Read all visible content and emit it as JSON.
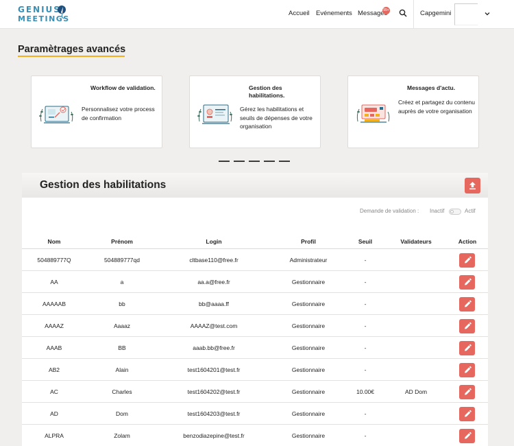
{
  "header": {
    "logo_line1": "GENIUS",
    "logo_line2": "MEETINGS",
    "nav": [
      "Accueil",
      "Evénements",
      "Messages"
    ],
    "messages_badge": "99+",
    "company": "Capgemini"
  },
  "page": {
    "title": "Paramètrages avancés"
  },
  "cards": [
    {
      "title": "Workflow de validation.",
      "description": "Personnalisez votre process de confirmation"
    },
    {
      "title": "Gestion des habilitations.",
      "description": "Gérez les habilitations et seuils de dépenses de votre organisation"
    },
    {
      "title": "Messages d'actu.",
      "description": "Créez et partagez du contenu auprès de votre organisation"
    }
  ],
  "panel": {
    "title": "Gestion des habilitations",
    "validation_label": "Demande de validation :",
    "inactive_label": "Inactif",
    "active_label": "Actif"
  },
  "table": {
    "columns": [
      "Nom",
      "Prénom",
      "Login",
      "Profil",
      "Seuil",
      "Validateurs",
      "Action"
    ],
    "rows": [
      {
        "nom": "504889777Q",
        "prenom": "504889777qd",
        "login": "cltbase110@free.fr",
        "profil": "Administrateur",
        "seuil": "-",
        "validateurs": ""
      },
      {
        "nom": "AA",
        "prenom": "a",
        "login": "aa.a@free.fr",
        "profil": "Gestionnaire",
        "seuil": "-",
        "validateurs": ""
      },
      {
        "nom": "AAAAAB",
        "prenom": "bb",
        "login": "bb@aaaa.ff",
        "profil": "Gestionnaire",
        "seuil": "-",
        "validateurs": ""
      },
      {
        "nom": "AAAAZ",
        "prenom": "Aaaaz",
        "login": "AAAAZ@test.com",
        "profil": "Gestionnaire",
        "seuil": "-",
        "validateurs": ""
      },
      {
        "nom": "AAAB",
        "prenom": "BB",
        "login": "aaab.bb@free.fr",
        "profil": "Gestionnaire",
        "seuil": "-",
        "validateurs": ""
      },
      {
        "nom": "AB2",
        "prenom": "Alain",
        "login": "test1604201@test.fr",
        "profil": "Gestionnaire",
        "seuil": "-",
        "validateurs": ""
      },
      {
        "nom": "AC",
        "prenom": "Charles",
        "login": "test1604202@test.fr",
        "profil": "Gestionnaire",
        "seuil": "10.00€",
        "validateurs": "AD Dom"
      },
      {
        "nom": "AD",
        "prenom": "Dom",
        "login": "test1604203@test.fr",
        "profil": "Gestionnaire",
        "seuil": "-",
        "validateurs": ""
      },
      {
        "nom": "ALPRA",
        "prenom": "Zolam",
        "login": "benzodiazepine@test.fr",
        "profil": "Gestionnaire",
        "seuil": "-",
        "validateurs": ""
      }
    ]
  },
  "colors": {
    "accent": "#e5675e",
    "title_underline": "#f2b01e",
    "logo": "#3a8fb5"
  }
}
